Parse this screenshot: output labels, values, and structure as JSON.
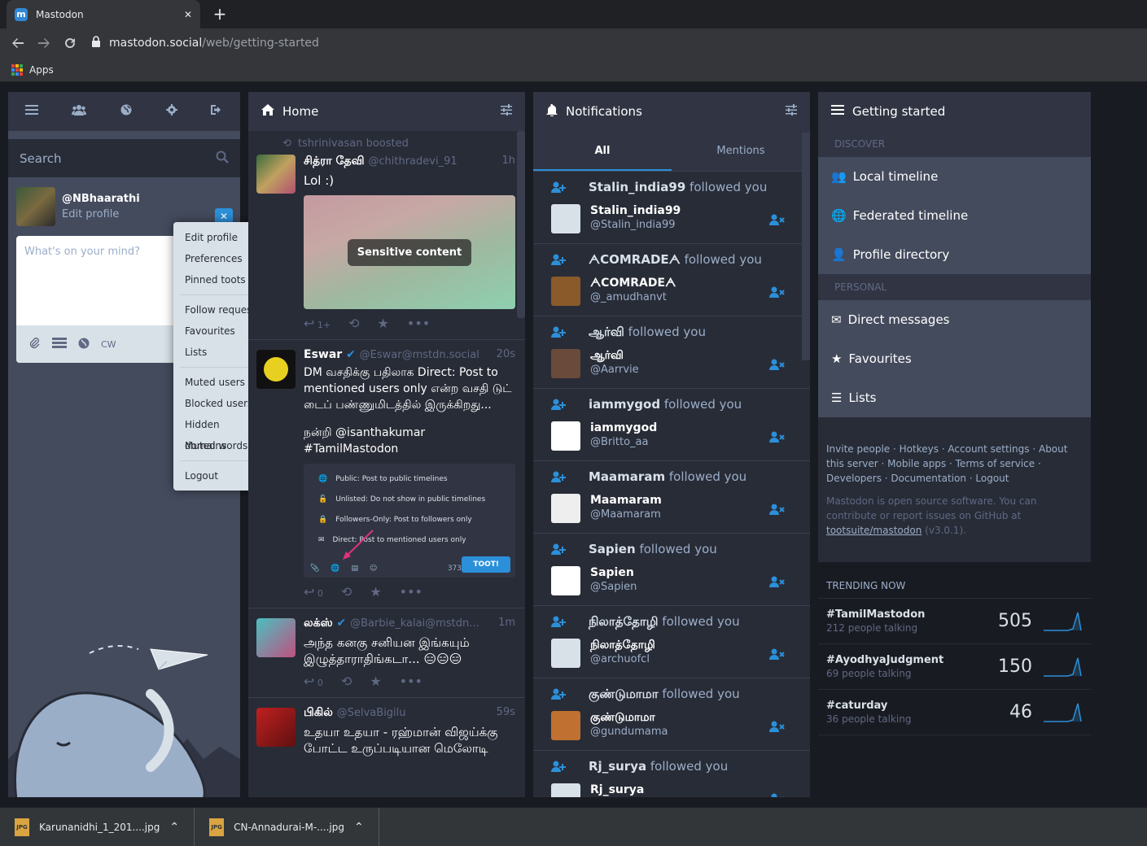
{
  "browser": {
    "tab_title": "Mastodon",
    "tab_close": "✕",
    "new_tab": "+",
    "url_host": "mastodon.social",
    "url_path": "/web/getting-started",
    "apps_label": "Apps"
  },
  "compose": {
    "search_placeholder": "Search",
    "account_handle": "@NBhaarathi",
    "edit_profile": "Edit profile",
    "textarea_placeholder": "What's on your mind?",
    "cw_label": "CW"
  },
  "menu": {
    "items_1": [
      "Edit profile",
      "Preferences",
      "Pinned toots"
    ],
    "items_2": [
      "Follow requests",
      "Favourites",
      "Lists"
    ],
    "items_3": [
      "Muted users",
      "Blocked users",
      "Hidden domains",
      "Muted words"
    ],
    "logout": "Logout"
  },
  "home": {
    "title": "Home",
    "status1": {
      "boosted_by": "tshrinivasan boosted",
      "name": "சித்ரா தேவி",
      "handle": "@chithradevi_91",
      "time": "1h",
      "text": "Lol :)",
      "sensitive": "Sensitive content",
      "replies": "1+"
    },
    "status2": {
      "name": "Eswar",
      "handle": "@Eswar@mstdn.social",
      "time": "20s",
      "text": "DM வசதிக்கு பதிலாக Direct: Post to mentioned users only என்ற வசதி டுட் டைப் பண்ணுமிடத்தில் இருக்கிறது...",
      "text2": "நன்றி @isanthakumar #TamilMastodon",
      "embed_rows": [
        "Public: Post to public timelines",
        "Unlisted: Do not show in public timelines",
        "Followers-Only: Post to followers only",
        "Direct: Post to mentioned users only"
      ],
      "embed_count": "373",
      "embed_toot": "TOOT!",
      "replies": "0"
    },
    "status3": {
      "name": "லக்ஸ்",
      "handle": "@Barbie_kalai@mstdn...",
      "time": "1m",
      "text": "அந்த கனகு சனியன இங்கயும் இழுத்தாராதிங்கடா... 😑😑😑",
      "replies": "0"
    },
    "status4": {
      "name": "பிகில்",
      "handle": "@SelvaBigilu",
      "time": "59s",
      "text": "உதயா உதயா - ரஹ்மான் விஜய்க்கு போட்ட உருப்படியான மெலோடி"
    }
  },
  "notifications": {
    "title": "Notifications",
    "tab_all": "All",
    "tab_mentions": "Mentions",
    "followed_suffix": "followed you",
    "items": [
      {
        "name": "Stalin_india99",
        "handle": "@Stalin_india99"
      },
      {
        "name": "ᗅCOMRADEᗅ",
        "handle": "@_amudhanvt"
      },
      {
        "name": "ஆர்வி",
        "handle": "@Aarrvie"
      },
      {
        "name": "iammygod",
        "handle": "@Britto_aa"
      },
      {
        "name": "Maamaram",
        "handle": "@Maamaram"
      },
      {
        "name": "Sapien",
        "handle": "@Sapien"
      },
      {
        "name": "நிலாத்தோழி",
        "handle": "@archuofcl"
      },
      {
        "name": "குண்டுமாமா",
        "handle": "@gundumama"
      },
      {
        "name": "Rj_surya",
        "handle": ""
      }
    ]
  },
  "getting_started": {
    "title": "Getting started",
    "discover": "Discover",
    "local": "Local timeline",
    "federated": "Federated timeline",
    "directory": "Profile directory",
    "personal": "Personal",
    "dm": "Direct messages",
    "favourites": "Favourites",
    "lists": "Lists",
    "links": [
      "Invite people",
      "Hotkeys",
      "Account settings",
      "About this server",
      "Mobile apps",
      "Terms of service",
      "Developers",
      "Documentation",
      "Logout"
    ],
    "oss_text": "Mastodon is open source software. You can contribute or report issues on GitHub at",
    "oss_link": "tootsuite/mastodon",
    "version": "(v3.0.1).",
    "trending_title": "Trending now",
    "trends": [
      {
        "tag": "#TamilMastodon",
        "people": "212 people talking",
        "uses": "505"
      },
      {
        "tag": "#AyodhyaJudgment",
        "people": "69 people talking",
        "uses": "150"
      },
      {
        "tag": "#caturday",
        "people": "36 people talking",
        "uses": "46"
      }
    ]
  },
  "downloads": [
    {
      "name": "Karunanidhi_1_201....jpg"
    },
    {
      "name": "CN-Annadurai-M-....jpg"
    }
  ],
  "colors": {
    "accent": "#2b90d9",
    "bg": "#191b22",
    "column": "#282c37"
  }
}
